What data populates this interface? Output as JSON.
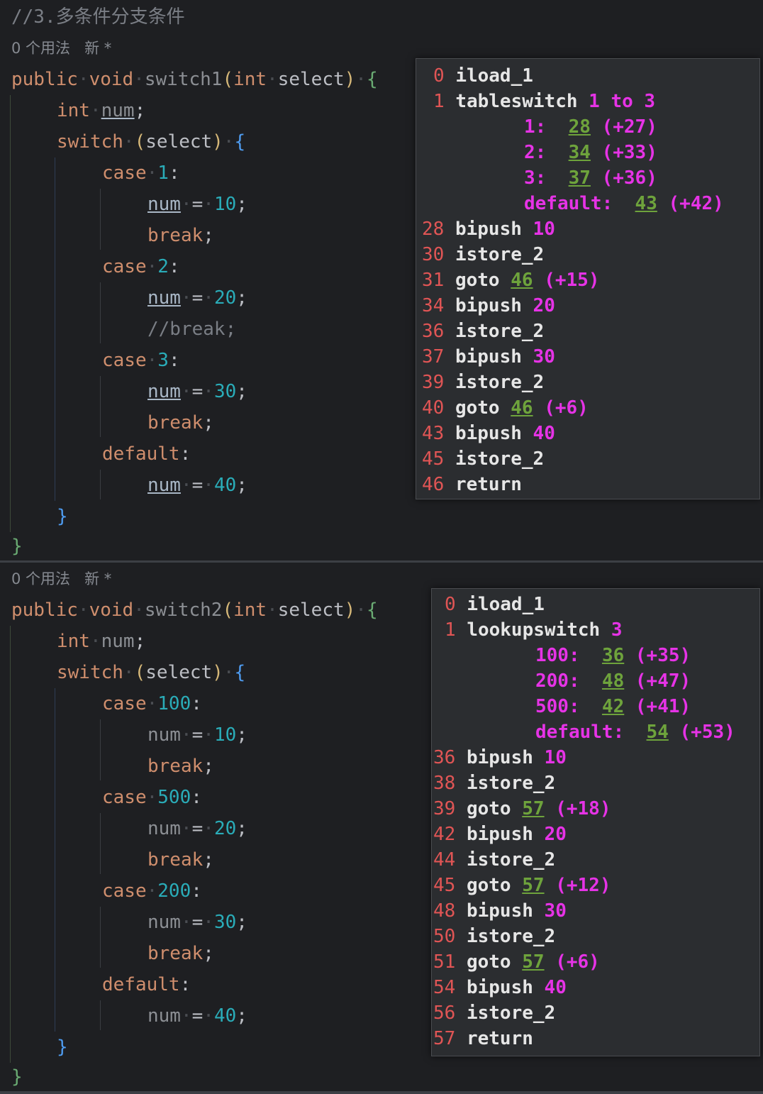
{
  "pane1": {
    "comment": "//3.多条件分支条件",
    "usage": "0 个用法",
    "new_marker": "新 *",
    "method_name": "switch1",
    "code": {
      "public": "public",
      "void": "void",
      "param_type": "int",
      "param_name": "select",
      "decl_type": "int",
      "decl_name": "num",
      "switch": "switch",
      "switch_arg": "select",
      "case_kw": "case",
      "default_kw": "default",
      "break_kw": "break",
      "commented_break": "//break;",
      "cases": [
        "1",
        "2",
        "3"
      ],
      "values": [
        "10",
        "20",
        "30",
        "40"
      ]
    },
    "bytecode": [
      {
        "offset": "0",
        "op": "iload_1"
      },
      {
        "offset": "1",
        "op": "tableswitch",
        "args": "1 to 3"
      },
      {
        "label": "1:",
        "target": "28",
        "delta": "(+27)"
      },
      {
        "label": "2:",
        "target": "34",
        "delta": "(+33)"
      },
      {
        "label": "3:",
        "target": "37",
        "delta": "(+36)"
      },
      {
        "label": "default:",
        "target": "43",
        "delta": "(+42)"
      },
      {
        "offset": "28",
        "op": "bipush",
        "args": "10"
      },
      {
        "offset": "30",
        "op": "istore_2"
      },
      {
        "offset": "31",
        "op": "goto",
        "target": "46",
        "delta": "(+15)"
      },
      {
        "offset": "34",
        "op": "bipush",
        "args": "20"
      },
      {
        "offset": "36",
        "op": "istore_2"
      },
      {
        "offset": "37",
        "op": "bipush",
        "args": "30"
      },
      {
        "offset": "39",
        "op": "istore_2"
      },
      {
        "offset": "40",
        "op": "goto",
        "target": "46",
        "delta": "(+6)"
      },
      {
        "offset": "43",
        "op": "bipush",
        "args": "40"
      },
      {
        "offset": "45",
        "op": "istore_2"
      },
      {
        "offset": "46",
        "op": "return"
      }
    ]
  },
  "pane2": {
    "usage": "0 个用法",
    "new_marker": "新 *",
    "method_name": "switch2",
    "code": {
      "public": "public",
      "void": "void",
      "param_type": "int",
      "param_name": "select",
      "decl_type": "int",
      "decl_name": "num",
      "switch": "switch",
      "switch_arg": "select",
      "case_kw": "case",
      "default_kw": "default",
      "break_kw": "break",
      "cases": [
        "100",
        "500",
        "200"
      ],
      "values": [
        "10",
        "20",
        "30",
        "40"
      ]
    },
    "bytecode": [
      {
        "offset": "0",
        "op": "iload_1"
      },
      {
        "offset": "1",
        "op": "lookupswitch",
        "args": "3"
      },
      {
        "label": "100:",
        "target": "36",
        "delta": "(+35)"
      },
      {
        "label": "200:",
        "target": "48",
        "delta": "(+47)"
      },
      {
        "label": "500:",
        "target": "42",
        "delta": "(+41)"
      },
      {
        "label": "default:",
        "target": "54",
        "delta": "(+53)"
      },
      {
        "offset": "36",
        "op": "bipush",
        "args": "10"
      },
      {
        "offset": "38",
        "op": "istore_2"
      },
      {
        "offset": "39",
        "op": "goto",
        "target": "57",
        "delta": "(+18)"
      },
      {
        "offset": "42",
        "op": "bipush",
        "args": "20"
      },
      {
        "offset": "44",
        "op": "istore_2"
      },
      {
        "offset": "45",
        "op": "goto",
        "target": "57",
        "delta": "(+12)"
      },
      {
        "offset": "48",
        "op": "bipush",
        "args": "30"
      },
      {
        "offset": "50",
        "op": "istore_2"
      },
      {
        "offset": "51",
        "op": "goto",
        "target": "57",
        "delta": "(+6)"
      },
      {
        "offset": "54",
        "op": "bipush",
        "args": "40"
      },
      {
        "offset": "56",
        "op": "istore_2"
      },
      {
        "offset": "57",
        "op": "return"
      }
    ]
  }
}
